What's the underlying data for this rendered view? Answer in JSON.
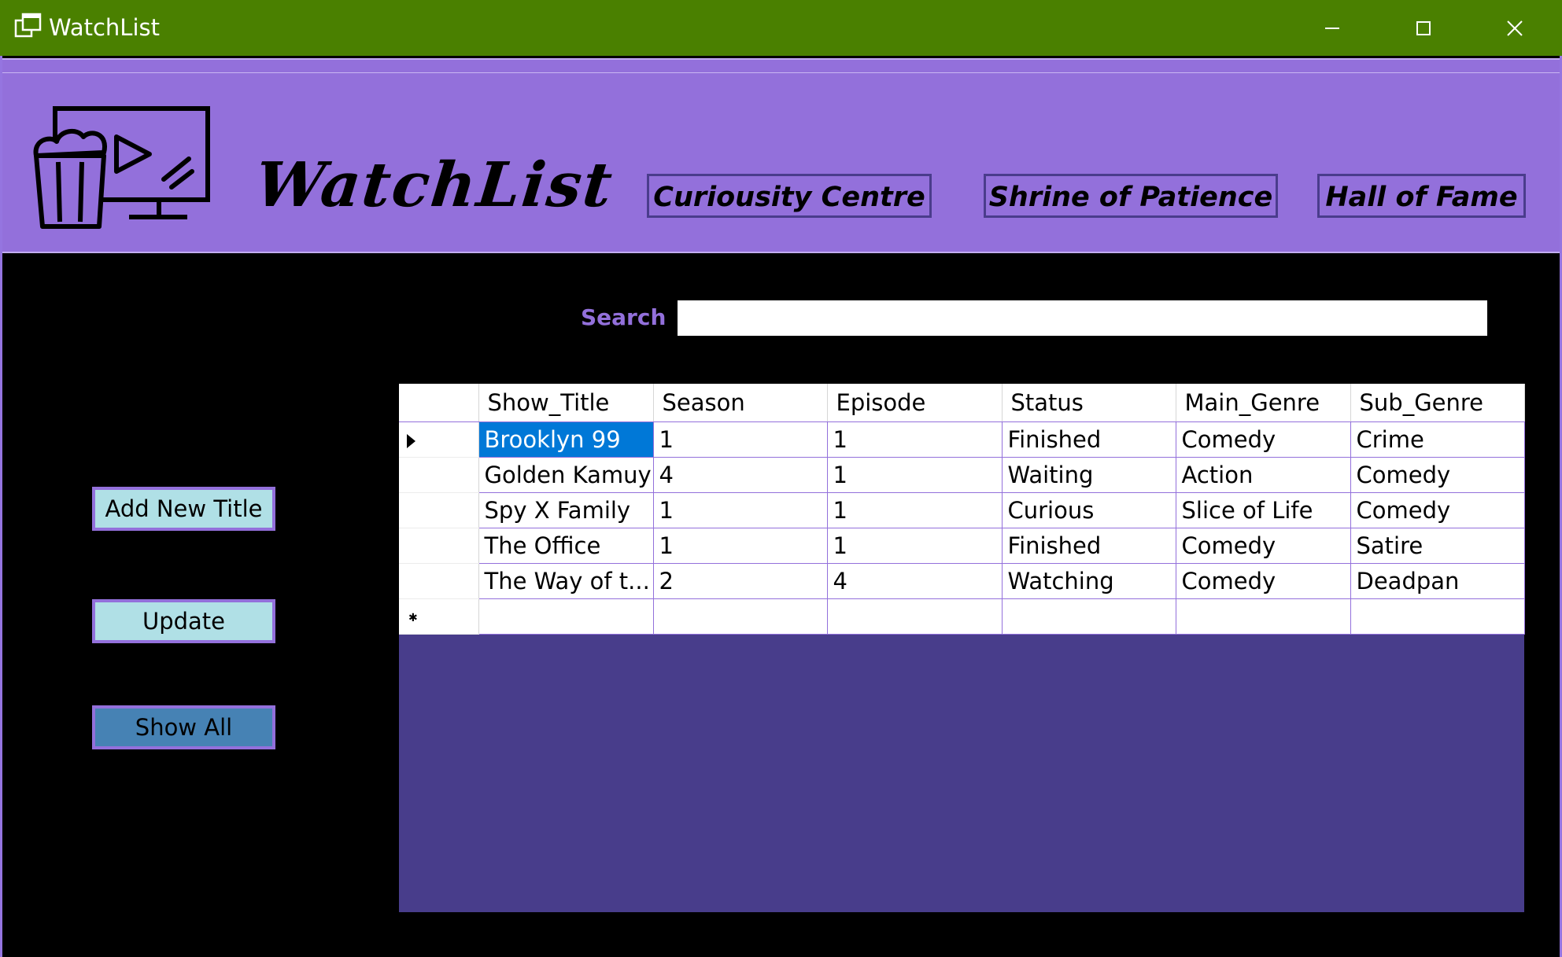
{
  "window": {
    "title": "WatchList",
    "minimize_icon": "minimize-icon",
    "maximize_icon": "maximize-icon",
    "close_icon": "close-icon",
    "titlebar_color": "#4a8000"
  },
  "header": {
    "brand": "WatchList",
    "logo_icon": "tv-popcorn-icon",
    "nav": [
      "Curiousity Centre",
      "Shrine of Patience",
      "Hall of Fame"
    ],
    "background_color": "#9370db"
  },
  "search": {
    "label": "Search",
    "value": ""
  },
  "actions": {
    "add_new_title": "Add New Title",
    "update": "Update",
    "show_all": "Show All"
  },
  "grid": {
    "columns": [
      "Show_Title",
      "Season",
      "Episode",
      "Status",
      "Main_Genre",
      "Sub_Genre"
    ],
    "rows": [
      [
        "Brooklyn 99",
        "1",
        "1",
        "Finished",
        "Comedy",
        "Crime"
      ],
      [
        "Golden Kamuy",
        "4",
        "1",
        "Waiting",
        "Action",
        "Comedy"
      ],
      [
        "Spy X Family",
        "1",
        "1",
        "Curious",
        "Slice of Life",
        "Comedy"
      ],
      [
        "The Office",
        "1",
        "1",
        "Finished",
        "Comedy",
        "Satire"
      ],
      [
        "The Way of t...",
        "2",
        "4",
        "Watching",
        "Comedy",
        "Deadpan"
      ]
    ],
    "selected_row": 0,
    "selection_color": "#0078d7",
    "background_color": "#483d8b"
  }
}
